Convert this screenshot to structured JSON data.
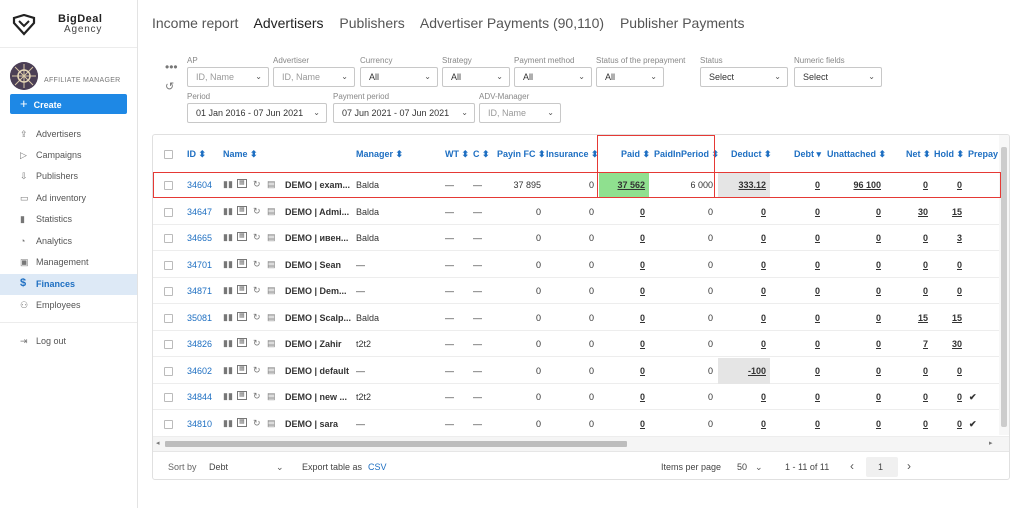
{
  "brand": {
    "line1": "BigDeal",
    "line2": "Agency"
  },
  "role": "AFFILIATE MANAGER",
  "create_label": "Create",
  "nav": [
    {
      "label": "Advertisers",
      "icon": "upload-icon"
    },
    {
      "label": "Campaigns",
      "icon": "play-icon"
    },
    {
      "label": "Publishers",
      "icon": "download-icon"
    },
    {
      "label": "Ad inventory",
      "icon": "file-icon"
    },
    {
      "label": "Statistics",
      "icon": "bar-chart-icon"
    },
    {
      "label": "Analytics",
      "icon": "pie-chart-icon"
    },
    {
      "label": "Management",
      "icon": "settings-icon"
    },
    {
      "label": "Finances",
      "icon": "dollar-icon",
      "active": true
    },
    {
      "label": "Employees",
      "icon": "people-icon"
    }
  ],
  "logout_label": "Log out",
  "tabs": [
    "Income report",
    "Advertisers",
    "Publishers",
    "Advertiser Payments (90,110)",
    "Publisher Payments"
  ],
  "active_tab": "Advertisers",
  "filters": {
    "ap": {
      "label": "AP",
      "placeholder": "ID, Name"
    },
    "advertiser": {
      "label": "Advertiser",
      "placeholder": "ID, Name"
    },
    "currency": {
      "label": "Currency",
      "value": "All"
    },
    "strategy": {
      "label": "Strategy",
      "value": "All"
    },
    "payment_method": {
      "label": "Payment method",
      "value": "All"
    },
    "prepayment_status": {
      "label": "Status of the prepayment",
      "value": "All"
    },
    "status": {
      "label": "Status",
      "value": "Select"
    },
    "numeric": {
      "label": "Numeric fields",
      "value": "Select"
    },
    "period": {
      "label": "Period",
      "value": "01 Jan 2016 - 07 Jun 2021"
    },
    "payment_period": {
      "label": "Payment period",
      "value": "07 Jun 2021 - 07 Jun 2021"
    },
    "adv_manager": {
      "label": "ADV-Manager",
      "placeholder": "ID, Name"
    }
  },
  "columns": [
    "ID",
    "Name",
    "Manager",
    "WT",
    "C",
    "Payin FC",
    "Insurance",
    "Paid",
    "PaidInPeriod",
    "Deduct",
    "Debt",
    "Unattached",
    "Net",
    "Hold",
    "Prepay"
  ],
  "rows": [
    {
      "id": "34604",
      "name": "DEMO | exam...",
      "manager": "Balda",
      "wt": "—",
      "c": "—",
      "payin": "37 895",
      "insurance": "0",
      "paid": "37 562",
      "paidp": "6 000",
      "deduct": "333.12",
      "debt": "0",
      "unattached": "96 100",
      "net": "0",
      "hold": "0",
      "prepay": ""
    },
    {
      "id": "34647",
      "name": "DEMO | Admi...",
      "manager": "Balda",
      "wt": "—",
      "c": "—",
      "payin": "0",
      "insurance": "0",
      "paid": "0",
      "paidp": "0",
      "deduct": "0",
      "debt": "0",
      "unattached": "0",
      "net": "30",
      "hold": "15",
      "prepay": ""
    },
    {
      "id": "34665",
      "name": "DEMO | ивен...",
      "manager": "Balda",
      "wt": "—",
      "c": "—",
      "payin": "0",
      "insurance": "0",
      "paid": "0",
      "paidp": "0",
      "deduct": "0",
      "debt": "0",
      "unattached": "0",
      "net": "0",
      "hold": "3",
      "prepay": ""
    },
    {
      "id": "34701",
      "name": "DEMO | Sean",
      "manager": "—",
      "wt": "—",
      "c": "—",
      "payin": "0",
      "insurance": "0",
      "paid": "0",
      "paidp": "0",
      "deduct": "0",
      "debt": "0",
      "unattached": "0",
      "net": "0",
      "hold": "0",
      "prepay": ""
    },
    {
      "id": "34871",
      "name": "DEMO | Dem...",
      "manager": "—",
      "wt": "—",
      "c": "—",
      "payin": "0",
      "insurance": "0",
      "paid": "0",
      "paidp": "0",
      "deduct": "0",
      "debt": "0",
      "unattached": "0",
      "net": "0",
      "hold": "0",
      "prepay": ""
    },
    {
      "id": "35081",
      "name": "DEMO | Scalp...",
      "manager": "Balda",
      "wt": "—",
      "c": "—",
      "payin": "0",
      "insurance": "0",
      "paid": "0",
      "paidp": "0",
      "deduct": "0",
      "debt": "0",
      "unattached": "0",
      "net": "15",
      "hold": "15",
      "prepay": ""
    },
    {
      "id": "34826",
      "name": "DEMO | Zahir",
      "manager": "t2t2",
      "wt": "—",
      "c": "—",
      "payin": "0",
      "insurance": "0",
      "paid": "0",
      "paidp": "0",
      "deduct": "0",
      "debt": "0",
      "unattached": "0",
      "net": "7",
      "hold": "30",
      "prepay": ""
    },
    {
      "id": "34602",
      "name": "DEMO | default",
      "manager": "—",
      "wt": "—",
      "c": "—",
      "payin": "0",
      "insurance": "0",
      "paid": "0",
      "paidp": "0",
      "deduct": "-100",
      "debt": "0",
      "unattached": "0",
      "net": "0",
      "hold": "0",
      "prepay": ""
    },
    {
      "id": "34844",
      "name": "DEMO | new ...",
      "manager": "t2t2",
      "wt": "—",
      "c": "—",
      "payin": "0",
      "insurance": "0",
      "paid": "0",
      "paidp": "0",
      "deduct": "0",
      "debt": "0",
      "unattached": "0",
      "net": "0",
      "hold": "0",
      "prepay": "✔"
    },
    {
      "id": "34810",
      "name": "DEMO | sara",
      "manager": "—",
      "wt": "—",
      "c": "—",
      "payin": "0",
      "insurance": "0",
      "paid": "0",
      "paidp": "0",
      "deduct": "0",
      "debt": "0",
      "unattached": "0",
      "net": "0",
      "hold": "0",
      "prepay": "✔"
    }
  ],
  "footer": {
    "sort_label": "Sort by",
    "sort_value": "Debt",
    "export_label": "Export table as",
    "export_link": "CSV",
    "per_page_label": "Items per page",
    "per_page_value": "50",
    "range": "1 - 11 of 11",
    "page": "1"
  },
  "colors": {
    "accent": "#1e88e5",
    "highlight_green": "#8fe08f",
    "highlight_box": "#e53935"
  }
}
